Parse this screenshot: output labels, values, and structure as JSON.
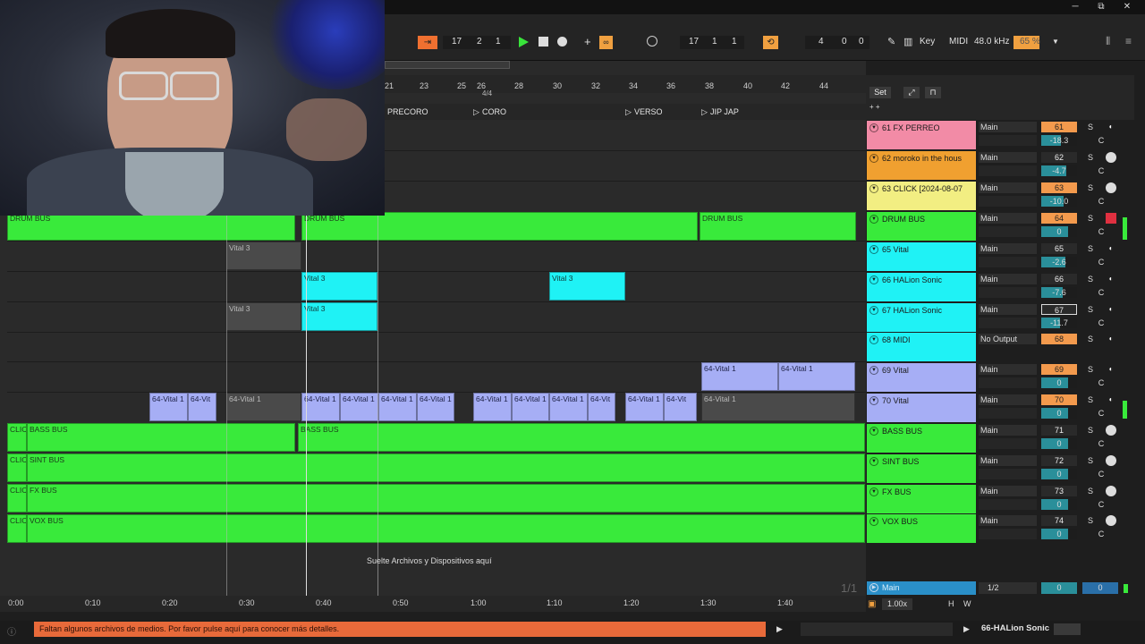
{
  "window": {
    "minimize": "─",
    "maximize": "⧉",
    "close": "✕"
  },
  "transport": {
    "position": [
      "17",
      "2",
      "1"
    ],
    "loop_start": [
      "17",
      "1",
      "1"
    ],
    "loop_length": [
      "4",
      "0",
      "0"
    ],
    "key_label": "Key",
    "midi_label": "MIDI",
    "sample_rate": "48.0 kHz",
    "cpu": "65 %"
  },
  "ruler": {
    "bars": [
      "21",
      "23",
      "25",
      "26",
      "28",
      "30",
      "32",
      "34",
      "36",
      "38",
      "40",
      "42",
      "44"
    ],
    "time_signature": "4/4",
    "locators": [
      "PRECORO",
      "CORO",
      "VERSO",
      "JIP JAP"
    ]
  },
  "mixer_header": {
    "set_label": "Set"
  },
  "tracks": [
    {
      "name": "61 FX PERREO",
      "io": "Main",
      "num": "61",
      "vol": "-18.3",
      "color": "#f28ba6",
      "solo": "S",
      "cue": "C"
    },
    {
      "name": "62 moroko in the hous",
      "io": "Main",
      "num": "62",
      "vol": "-4.7",
      "color": "#f0a030",
      "solo": "S",
      "cue": "C"
    },
    {
      "name": "63 CLICK [2024-08-07",
      "io": "Main",
      "num": "63",
      "vol": "-10.0",
      "color": "#f2ee82",
      "solo": "S",
      "cue": "C"
    },
    {
      "name": "DRUM BUS",
      "io": "Main",
      "num": "64",
      "vol": "0",
      "color": "#39ea3b",
      "solo": "S",
      "cue": "C"
    },
    {
      "name": "65 Vital",
      "io": "Main",
      "num": "65",
      "vol": "-2.6",
      "color": "#1ff2f5",
      "solo": "S",
      "cue": "C"
    },
    {
      "name": "66 HALion Sonic",
      "io": "Main",
      "num": "66",
      "vol": "-7.6",
      "color": "#1ff2f5",
      "solo": "S",
      "cue": "C"
    },
    {
      "name": "67 HALion Sonic",
      "io": "Main",
      "num": "67",
      "vol": "-11.7",
      "color": "#1ff2f5",
      "solo": "S",
      "cue": "C"
    },
    {
      "name": "68 MIDI",
      "io": "No Output",
      "num": "68",
      "vol": "",
      "color": "#1ff2f5",
      "solo": "S",
      "cue": ""
    },
    {
      "name": "69 Vital",
      "io": "Main",
      "num": "69",
      "vol": "0",
      "color": "#a6aef5",
      "solo": "S",
      "cue": "C"
    },
    {
      "name": "70 Vital",
      "io": "Main",
      "num": "70",
      "vol": "0",
      "color": "#a6aef5",
      "solo": "S",
      "cue": "C"
    },
    {
      "name": "BASS BUS",
      "io": "Main",
      "num": "71",
      "vol": "0",
      "color": "#39ea3b",
      "solo": "S",
      "cue": "C"
    },
    {
      "name": "SINT BUS",
      "io": "Main",
      "num": "72",
      "vol": "0",
      "color": "#39ea3b",
      "solo": "S",
      "cue": "C"
    },
    {
      "name": "FX BUS",
      "io": "Main",
      "num": "73",
      "vol": "0",
      "color": "#39ea3b",
      "solo": "S",
      "cue": "C"
    },
    {
      "name": "VOX BUS",
      "io": "Main",
      "num": "74",
      "vol": "0",
      "color": "#39ea3b",
      "solo": "S",
      "cue": "C"
    }
  ],
  "clips": {
    "click": "CLIC",
    "drum_bus": "DRUM BUS",
    "vital3": "Vital 3",
    "vital1": "64-Vital 1",
    "vital1_short": "64-Vit",
    "bass_bus": "BASS BUS",
    "sint_bus": "SINT BUS",
    "fx_bus": "FX BUS",
    "vox_bus": "VOX BUS"
  },
  "drop_hint": "Suelte Archivos y Dispositivos aquí",
  "page_indicator": "1/1",
  "master": {
    "name": "Main",
    "io": "1/2",
    "vol": "0",
    "pan": "0"
  },
  "timeline": [
    "0:00",
    "0:10",
    "0:20",
    "0:30",
    "0:40",
    "0:50",
    "1:00",
    "1:10",
    "1:20",
    "1:30",
    "1:40"
  ],
  "zoom": "1.00x",
  "hw": [
    "H",
    "W"
  ],
  "status": {
    "message": "Faltan algunos archivos de medios. Por favor pulse aquí para conocer más detalles.",
    "selected_track": "66-HALion Sonic"
  }
}
